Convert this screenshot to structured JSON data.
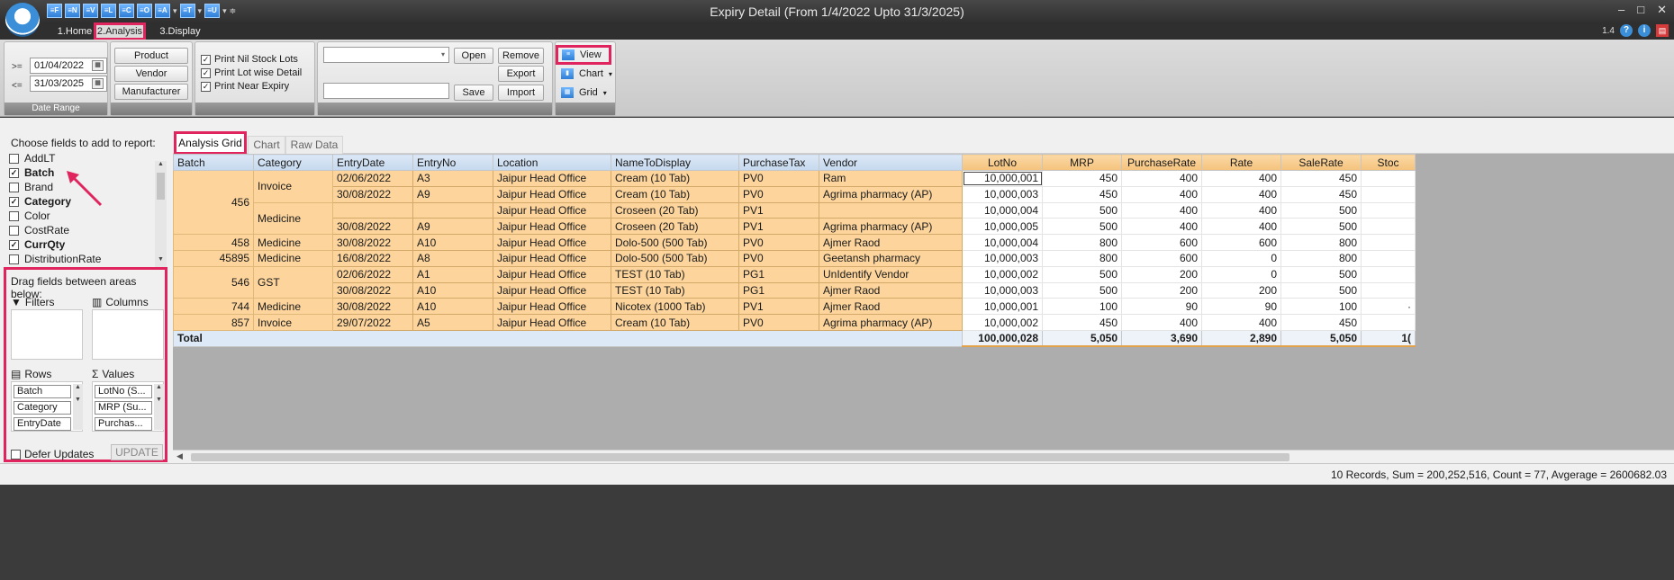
{
  "window": {
    "title": "Expiry Detail (From 1/4/2022 Upto 31/3/2025)",
    "version": "1.4",
    "logo_letter": "S",
    "minimize_glyph": "–",
    "maximize_glyph": "□",
    "close_glyph": "✕"
  },
  "quick_access": [
    {
      "label": "≡F"
    },
    {
      "label": "≡N"
    },
    {
      "label": "≡V"
    },
    {
      "label": "≡L"
    },
    {
      "label": "≡C"
    },
    {
      "label": "≡O"
    },
    {
      "label": "≡A"
    },
    {
      "label": "≡T"
    },
    {
      "label": "≡U"
    }
  ],
  "tabs": {
    "home": "1.Home",
    "analysis": "2.Analysis",
    "display": "3.Display"
  },
  "ribbon": {
    "date_range": {
      "from_op": ">=",
      "from": "01/04/2022",
      "to_op": "<=",
      "to": "31/03/2025",
      "label": "Date Range"
    },
    "buttons": {
      "product": "Product",
      "vendor": "Vendor",
      "manufacturer": "Manufacturer"
    },
    "options": [
      {
        "label": "Print Nil Stock Lots",
        "checked": true
      },
      {
        "label": "Print Lot wise Detail",
        "checked": true
      },
      {
        "label": "Print Near Expiry",
        "checked": true
      }
    ],
    "layout": {
      "open": "Open",
      "remove": "Remove",
      "export": "Export",
      "save": "Save",
      "import": "Import"
    },
    "view": {
      "view": "View",
      "chart": "Chart",
      "grid": "Grid"
    }
  },
  "field_list": {
    "title": "Choose fields to add to report:",
    "items": [
      {
        "label": "AddLT",
        "checked": false,
        "bold": false
      },
      {
        "label": "Batch",
        "checked": true,
        "bold": true
      },
      {
        "label": "Brand",
        "checked": false,
        "bold": false
      },
      {
        "label": "Category",
        "checked": true,
        "bold": true
      },
      {
        "label": "Color",
        "checked": false,
        "bold": false
      },
      {
        "label": "CostRate",
        "checked": false,
        "bold": false
      },
      {
        "label": "CurrQty",
        "checked": true,
        "bold": true
      },
      {
        "label": "DistributionRate",
        "checked": false,
        "bold": false
      }
    ]
  },
  "areas": {
    "title": "Drag fields between areas below:",
    "filters": "Filters",
    "columns": "Columns",
    "rows": "Rows",
    "values": "Values",
    "row_fields": [
      "Batch",
      "Category",
      "EntryDate"
    ],
    "value_fields": [
      "LotNo (S...",
      "MRP (Su...",
      "Purchas..."
    ],
    "defer": "Defer Updates",
    "update": "UPDATE"
  },
  "subtabs": {
    "grid": "Analysis Grid",
    "chart": "Chart",
    "raw": "Raw Data"
  },
  "grid": {
    "dim_headers": [
      "Batch",
      "Category",
      "EntryDate",
      "EntryNo",
      "Location",
      "NameToDisplay",
      "PurchaseTax",
      "Vendor"
    ],
    "value_headers": [
      "LotNo",
      "MRP",
      "PurchaseRate",
      "Rate",
      "SaleRate",
      "Stoc"
    ],
    "batches": [
      {
        "batch": "456",
        "categories": [
          {
            "category": "Invoice",
            "rows": [
              {
                "date": "02/06/2022",
                "no": "A3",
                "loc": "Jaipur Head Office",
                "name": "Cream (10 Tab)",
                "tax": "PV0",
                "vendor": "Ram",
                "lot": "10,000,001",
                "mrp": "450",
                "pr": "400",
                "rate": "400",
                "sale": "450",
                "stock": ""
              },
              {
                "date": "30/08/2022",
                "no": "A9",
                "loc": "Jaipur Head Office",
                "name": "Cream (10 Tab)",
                "tax": "PV0",
                "vendor": "Agrima pharmacy (AP)",
                "lot": "10,000,003",
                "mrp": "450",
                "pr": "400",
                "rate": "400",
                "sale": "450",
                "stock": ""
              }
            ]
          },
          {
            "category": "Medicine",
            "rows": [
              {
                "date": "",
                "no": "",
                "loc": "Jaipur Head Office",
                "name": "Croseen (20 Tab)",
                "tax": "PV1",
                "vendor": "",
                "lot": "10,000,004",
                "mrp": "500",
                "pr": "400",
                "rate": "400",
                "sale": "500",
                "stock": ""
              },
              {
                "date": "30/08/2022",
                "no": "A9",
                "loc": "Jaipur Head Office",
                "name": "Croseen (20 Tab)",
                "tax": "PV1",
                "vendor": "Agrima pharmacy (AP)",
                "lot": "10,000,005",
                "mrp": "500",
                "pr": "400",
                "rate": "400",
                "sale": "500",
                "stock": ""
              }
            ]
          }
        ]
      },
      {
        "batch": "458",
        "categories": [
          {
            "category": "Medicine",
            "rows": [
              {
                "date": "30/08/2022",
                "no": "A10",
                "loc": "Jaipur Head Office",
                "name": "Dolo-500 (500 Tab)",
                "tax": "PV0",
                "vendor": "Ajmer Raod",
                "lot": "10,000,004",
                "mrp": "800",
                "pr": "600",
                "rate": "600",
                "sale": "800",
                "stock": ""
              }
            ]
          }
        ]
      },
      {
        "batch": "45895",
        "categories": [
          {
            "category": "Medicine",
            "rows": [
              {
                "date": "16/08/2022",
                "no": "A8",
                "loc": "Jaipur Head Office",
                "name": "Dolo-500 (500 Tab)",
                "tax": "PV0",
                "vendor": "Geetansh pharmacy",
                "lot": "10,000,003",
                "mrp": "800",
                "pr": "600",
                "rate": "0",
                "sale": "800",
                "stock": ""
              }
            ]
          }
        ]
      },
      {
        "batch": "546",
        "categories": [
          {
            "category": "GST",
            "rows": [
              {
                "date": "02/06/2022",
                "no": "A1",
                "loc": "Jaipur Head Office",
                "name": "TEST (10 Tab)",
                "tax": "PG1",
                "vendor": "UnIdentify Vendor",
                "lot": "10,000,002",
                "mrp": "500",
                "pr": "200",
                "rate": "0",
                "sale": "500",
                "stock": ""
              },
              {
                "date": "30/08/2022",
                "no": "A10",
                "loc": "Jaipur Head Office",
                "name": "TEST (10 Tab)",
                "tax": "PG1",
                "vendor": "Ajmer Raod",
                "lot": "10,000,003",
                "mrp": "500",
                "pr": "200",
                "rate": "200",
                "sale": "500",
                "stock": ""
              }
            ]
          }
        ]
      },
      {
        "batch": "744",
        "categories": [
          {
            "category": "Medicine",
            "rows": [
              {
                "date": "30/08/2022",
                "no": "A10",
                "loc": "Jaipur Head Office",
                "name": "Nicotex (1000 Tab)",
                "tax": "PV1",
                "vendor": "Ajmer Raod",
                "lot": "10,000,001",
                "mrp": "100",
                "pr": "90",
                "rate": "90",
                "sale": "100",
                "stock": "·"
              }
            ]
          }
        ]
      },
      {
        "batch": "857",
        "categories": [
          {
            "category": "Invoice",
            "rows": [
              {
                "date": "29/07/2022",
                "no": "A5",
                "loc": "Jaipur Head Office",
                "name": "Cream (10 Tab)",
                "tax": "PV0",
                "vendor": "Agrima pharmacy (AP)",
                "lot": "10,000,002",
                "mrp": "450",
                "pr": "400",
                "rate": "400",
                "sale": "450",
                "stock": ""
              }
            ]
          }
        ]
      }
    ],
    "total": {
      "label": "Total",
      "lot": "100,000,028",
      "mrp": "5,050",
      "pr": "3,690",
      "rate": "2,890",
      "sale": "5,050",
      "stock": "1("
    }
  },
  "status": {
    "text": "10 Records, Sum = 200,252,516, Count = 77, Avgerage = 2600682.03"
  },
  "colors": {
    "highlight": "#e0245e",
    "row_header": "#fcd49c",
    "value_header": "#f4c27c",
    "column_header": "#c5d8ee"
  }
}
